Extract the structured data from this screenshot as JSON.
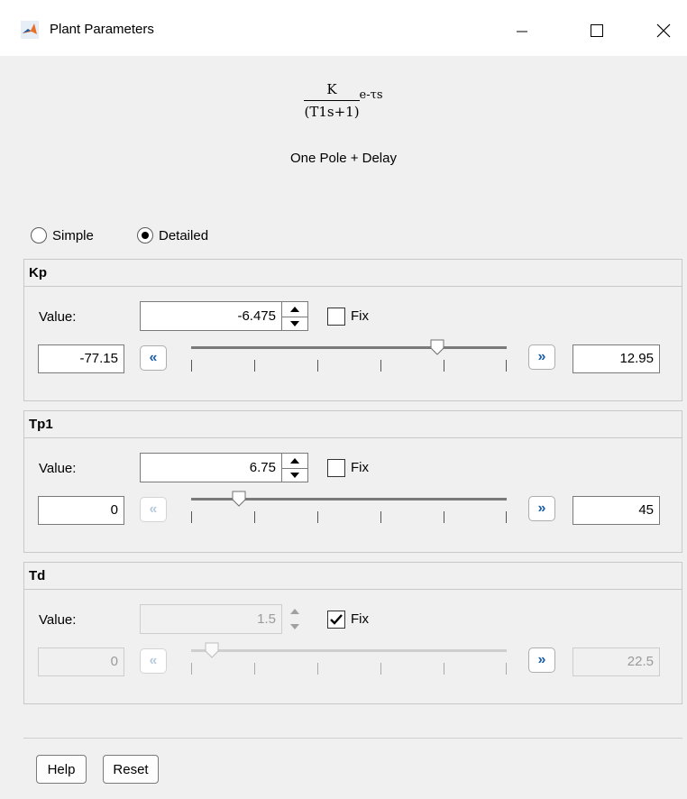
{
  "window": {
    "title": "Plant Parameters"
  },
  "formula": {
    "numerator": "K",
    "denominator": "(T1s+1)",
    "exponent": "e-τs"
  },
  "model_name": "One Pole + Delay",
  "mode": {
    "options": [
      "Simple",
      "Detailed"
    ],
    "selected": "Detailed"
  },
  "params": [
    {
      "name": "Kp",
      "value_label": "Value:",
      "value": "-6.475",
      "fix_label": "Fix",
      "fixed": false,
      "min": "-77.15",
      "max": "12.95",
      "slider_fraction": 0.78,
      "enabled": true,
      "left_nav_enabled": true
    },
    {
      "name": "Tp1",
      "value_label": "Value:",
      "value": "6.75",
      "fix_label": "Fix",
      "fixed": false,
      "min": "0",
      "max": "45",
      "slider_fraction": 0.15,
      "enabled": true,
      "left_nav_enabled": false
    },
    {
      "name": "Td",
      "value_label": "Value:",
      "value": "1.5",
      "fix_label": "Fix",
      "fixed": true,
      "min": "0",
      "max": "22.5",
      "slider_fraction": 0.066,
      "enabled": false,
      "left_nav_enabled": false
    }
  ],
  "buttons": {
    "help": "Help",
    "reset": "Reset"
  },
  "icons": {
    "app": "matlab-icon",
    "minimize": "minimize-icon",
    "maximize": "maximize-icon",
    "close": "close-icon",
    "nav_left": "double-chevron-left-icon",
    "nav_right": "double-chevron-right-icon"
  },
  "colors": {
    "nav_arrow": "#1f5fa6",
    "window_bg": "#f0f0f0"
  }
}
